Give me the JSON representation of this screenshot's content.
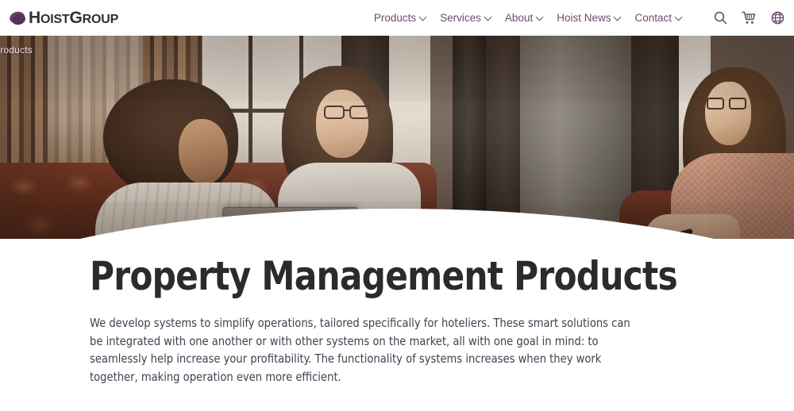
{
  "brand": {
    "logo_mark": "hoist-ellipse-mark",
    "name_part1": "H",
    "name_part2": "OIST",
    "name_part3": "G",
    "name_part4": "ROUP",
    "full_name": "HoistGroup",
    "mark_color": "#53325b",
    "text_color": "#2f3034"
  },
  "nav": {
    "accent_color": "#6e4c6b",
    "items": [
      {
        "label": "Products",
        "has_dropdown": true
      },
      {
        "label": "Services",
        "has_dropdown": true
      },
      {
        "label": "About",
        "has_dropdown": true
      },
      {
        "label": "Hoist News",
        "has_dropdown": true
      },
      {
        "label": "Contact",
        "has_dropdown": true
      }
    ],
    "icons": [
      {
        "name": "search-icon",
        "title": "Search"
      },
      {
        "name": "cart-icon",
        "title": "Cart"
      },
      {
        "name": "globe-icon",
        "title": "Language"
      }
    ]
  },
  "hero": {
    "breadcrumb": "Products",
    "alt": "Three women in conversation on a brown leather chesterfield sofa with a laptop"
  },
  "main": {
    "title": "Property Management Products",
    "intro": "We develop systems to simplify operations, tailored specifically for hoteliers. These smart solutions can be integrated with one another or with other systems on the market, all with one goal in mind: to seamlessly help increase your profitability. The functionality of systems increases when they work together, making operation even more efficient.",
    "title_color": "#2b2b2b",
    "intro_color": "#3c4450"
  }
}
